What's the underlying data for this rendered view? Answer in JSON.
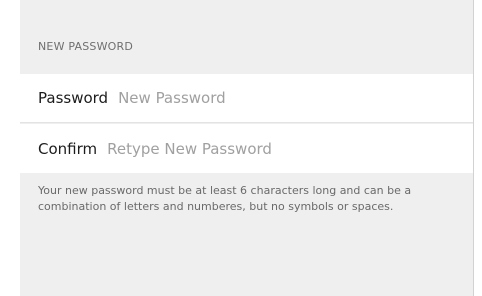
{
  "section": {
    "header": "NEW PASSWORD"
  },
  "fields": {
    "password": {
      "label": "Password",
      "placeholder": "New Password",
      "value": ""
    },
    "confirm": {
      "label": "Confirm",
      "placeholder": "Retype New Password",
      "value": ""
    }
  },
  "hint": "Your new password must be at least 6 characters long and can be a combination of letters and numberes, but no symbols or spaces.",
  "colors": {
    "panel_background": "#efefef",
    "row_background": "#ffffff",
    "label_text": "#1c1c1c",
    "placeholder_text": "#a0a0a0",
    "secondary_text": "#6f6f6f"
  }
}
